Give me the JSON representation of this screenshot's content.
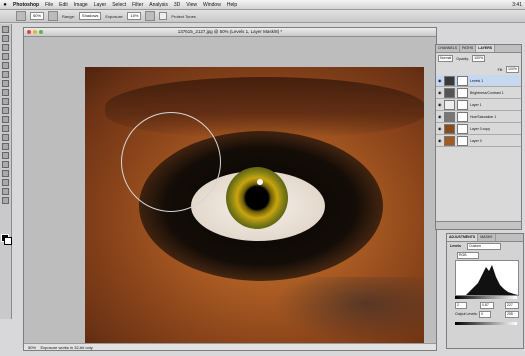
{
  "menubar": {
    "apple": "",
    "items": [
      "Photoshop",
      "File",
      "Edit",
      "Image",
      "Layer",
      "Select",
      "Filter",
      "Analysis",
      "3D",
      "View",
      "Window",
      "Help"
    ],
    "right": "3:41"
  },
  "options": {
    "range_label": "Range:",
    "range_value": "Shadows",
    "exposure_label": "Exposure:",
    "exposure_value": "15%",
    "protect_label": "Protect Tones",
    "zoom": "50%"
  },
  "document": {
    "title": "137615_2127.jpg @ 50% (Levels 1, Layer Mask/8) *",
    "status_zoom": "50%",
    "status_text": "Exposure works in 32-bit only"
  },
  "layers_panel": {
    "tabs": [
      "CHANNELS",
      "PATHS",
      "LAYERS"
    ],
    "blend_mode": "Normal",
    "opacity_label": "Opacity:",
    "opacity_value": "100%",
    "fill_label": "Fill:",
    "fill_value": "100%",
    "layers": [
      {
        "name": "Levels 1",
        "selected": true,
        "thumb": "#3a3a3a"
      },
      {
        "name": "Brightness/Contrast 1",
        "selected": false,
        "thumb": "#555555"
      },
      {
        "name": "Layer 1",
        "selected": false,
        "thumb": "#eeeeee"
      },
      {
        "name": "Hue/Saturation 1",
        "selected": false,
        "thumb": "#777777"
      },
      {
        "name": "Layer 0 copy",
        "selected": false,
        "thumb": "#8a4a1a"
      },
      {
        "name": "Layer 0",
        "selected": false,
        "thumb": "#a05a22"
      }
    ]
  },
  "adjustments": {
    "tabs": [
      "ADJUSTMENTS",
      "MASKS"
    ],
    "title": "Levels",
    "preset": "Custom",
    "channel": "RGB",
    "input": [
      "2",
      "0.87",
      "227"
    ],
    "output_label": "Output Levels:",
    "output": [
      "0",
      "255"
    ]
  }
}
